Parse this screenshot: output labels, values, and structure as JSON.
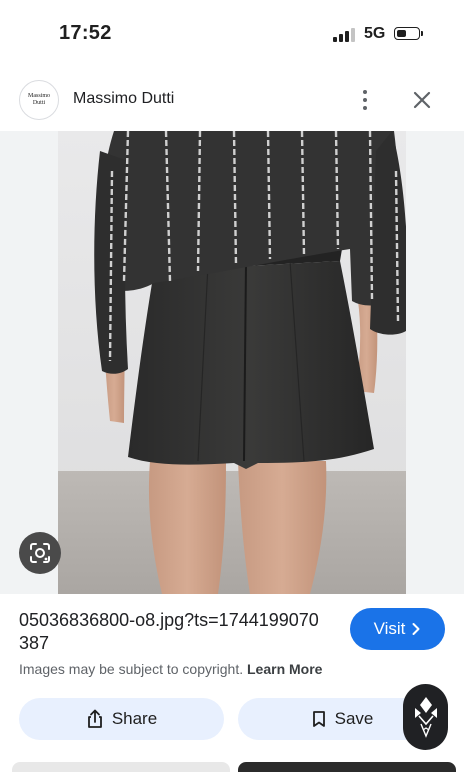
{
  "status_bar": {
    "time": "17:52",
    "network": "5G",
    "signal_bars": 4,
    "signal_bars_active": 3,
    "battery_level": 0.35
  },
  "header": {
    "site_logo_lines": [
      "Massimo",
      "Dutti"
    ],
    "site_name": "Massimo Dutti",
    "more_icon": "more-vert-icon",
    "close_icon": "close-icon"
  },
  "image": {
    "alt": "Model wearing a black embroidered shirt and dark pleated shorts",
    "lens_icon": "google-lens-icon"
  },
  "info": {
    "file_name": "05036836800-o8.jpg?ts=1744199070387",
    "visit_label": "Visit",
    "visit_icon": "chevron-right-icon",
    "copyright_text": "Images may be subject to copyright.",
    "learn_more": "Learn More"
  },
  "actions": {
    "share_label": "Share",
    "share_icon": "share-icon",
    "save_label": "Save",
    "save_icon": "bookmark-icon",
    "fab_icon": "diamond-logo-icon"
  },
  "colors": {
    "accent": "#1a73e8",
    "chip_background": "#e8f0fe",
    "text_primary": "#202124",
    "text_secondary": "#5f6368"
  }
}
